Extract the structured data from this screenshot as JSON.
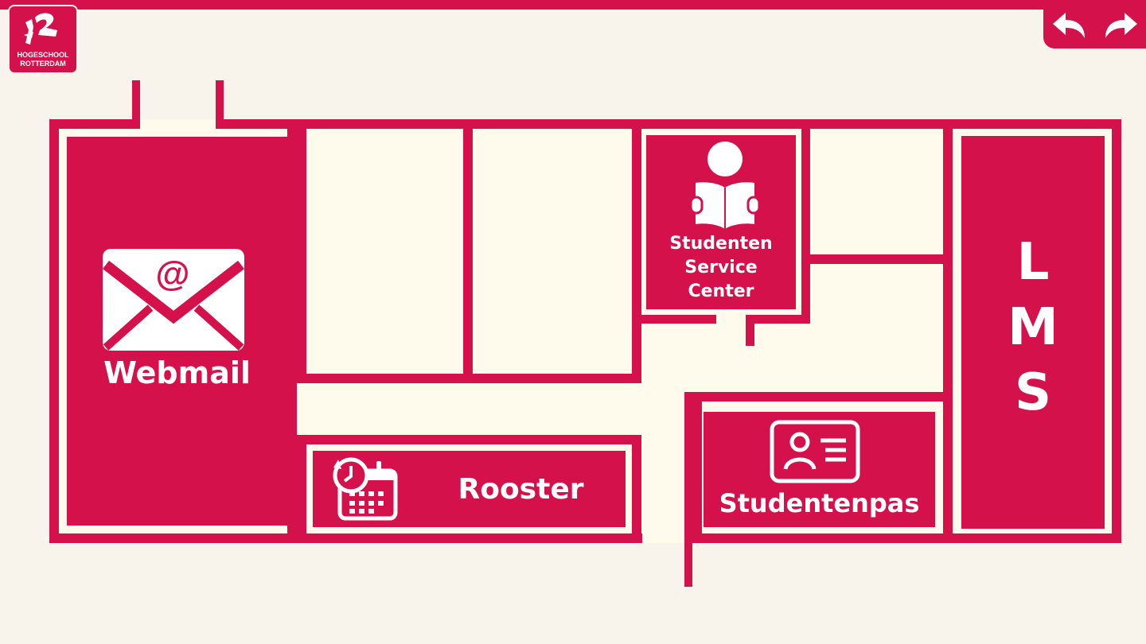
{
  "logo": {
    "line1": "HOGESCHOOL",
    "line2": "ROTTERDAM"
  },
  "nav": {
    "back_icon": "back-arrow-icon",
    "forward_icon": "forward-arrow-icon"
  },
  "rooms": {
    "webmail": {
      "label": "Webmail",
      "icon": "envelope-at-icon"
    },
    "rooster": {
      "label": "Rooster",
      "icon": "calendar-clock-icon"
    },
    "ssc": {
      "line1": "Studenten",
      "line2": "Service",
      "line3": "Center",
      "icon": "person-reading-icon"
    },
    "studentenpas": {
      "label": "Studentenpas",
      "icon": "id-card-icon"
    },
    "lms": {
      "l1": "L",
      "l2": "M",
      "l3": "S"
    }
  },
  "colors": {
    "accent": "#d4114a",
    "background": "#f8f4ec",
    "floor": "#fefbed",
    "text": "#ffffff"
  }
}
